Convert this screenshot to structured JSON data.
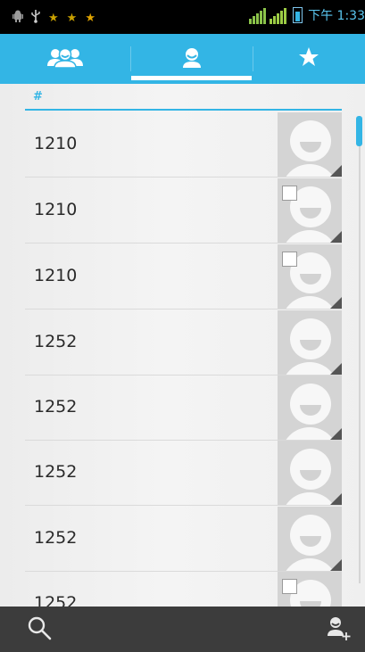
{
  "status_bar": {
    "time": "下午 1:33",
    "icons": [
      "android-debug-icon",
      "usb-icon",
      "star-notification-icon",
      "star-notification-icon",
      "star-notification-icon"
    ]
  },
  "tabs": [
    {
      "name": "groups",
      "icon": "groups-icon"
    },
    {
      "name": "all-contacts",
      "icon": "person-icon",
      "selected": true
    },
    {
      "name": "favorites",
      "icon": "star-icon"
    }
  ],
  "section_header": "#",
  "contacts": [
    {
      "name": "1210",
      "checkbox": false
    },
    {
      "name": "1210",
      "checkbox": true
    },
    {
      "name": "1210",
      "checkbox": true
    },
    {
      "name": "1252",
      "checkbox": false
    },
    {
      "name": "1252",
      "checkbox": false
    },
    {
      "name": "1252",
      "checkbox": false
    },
    {
      "name": "1252",
      "checkbox": false
    },
    {
      "name": "1252",
      "checkbox": true
    }
  ],
  "bottom_bar": {
    "left_icon": "search-icon",
    "right_icon": "add-contact-icon"
  },
  "colors": {
    "accent": "#33b5e5",
    "bottom_bar": "#3c3c3c",
    "status_bar": "#000000"
  }
}
